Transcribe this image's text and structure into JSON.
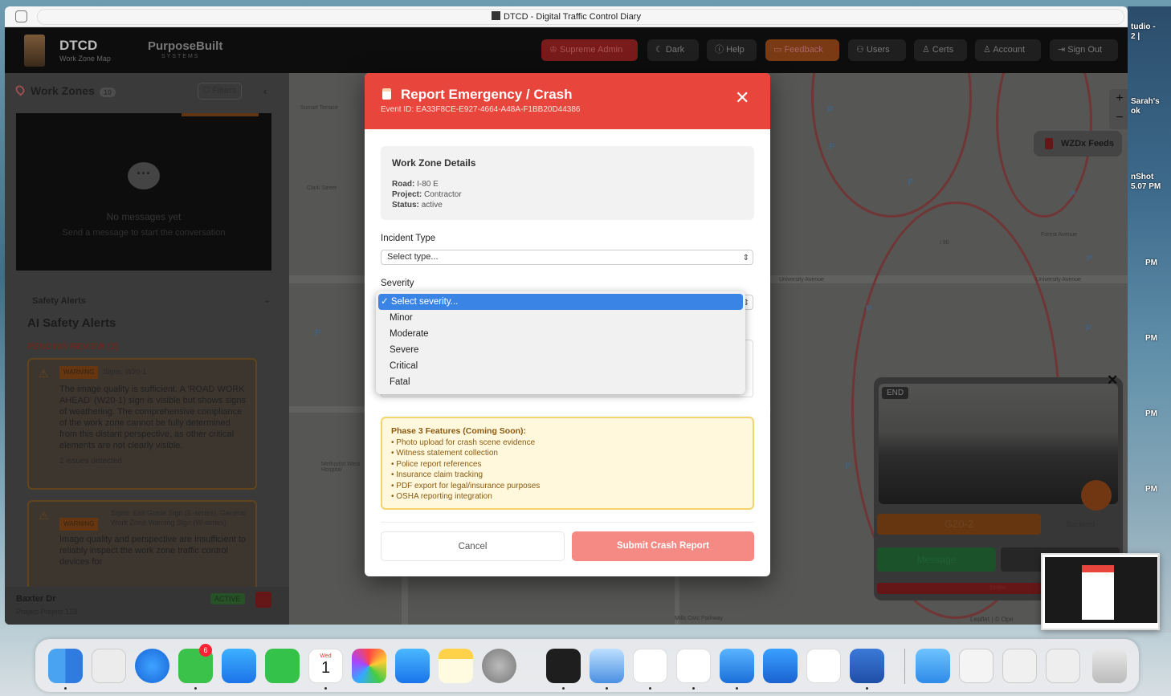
{
  "window": {
    "title": "DTCD - Digital Traffic Control Diary"
  },
  "app": {
    "brand": "DTCD",
    "brand_sub": "Work Zone Map",
    "partner": "PurposeBuilt",
    "partner_sub": "SYSTEMS",
    "nav": [
      "Supreme Admin",
      "Dark",
      "Help",
      "Feedback",
      "Users",
      "Certs",
      "Account",
      "Sign Out"
    ]
  },
  "sidebar": {
    "title": "Work Zones",
    "count": "10",
    "filters": "Filters",
    "chat_empty": "No messages yet",
    "chat_hint": "Send a message to start the conversation",
    "safety_alerts": "Safety Alerts",
    "ai_title": "AI Safety Alerts",
    "pending": "PENDING REVIEW (2)",
    "cards": [
      {
        "tag": "WARNING",
        "signs": "Signs: W20-1",
        "text": "The image quality is sufficient. A 'ROAD WORK AHEAD' (W20-1) sign is visible but shows signs of weathering. The comprehensive compliance of the work zone cannot be fully determined from this distant perspective, as other critical elements are not clearly visible.",
        "issues": "2 issues detected"
      },
      {
        "tag": "WARNING",
        "signs": "Signs: Exit Guide Sign (E-series), General Work Zone Warning Sign (W-series)",
        "text": "Image quality and perspective are insufficient to reliably inspect the work zone traffic control devices for",
        "issues": ""
      }
    ],
    "zone_name": "Baxter Dr",
    "zone_project": "Project Project 123",
    "zone_status": "ACTIVE"
  },
  "map": {
    "wzdx": "WZDx Feeds",
    "labels": [
      "Sunset Terrace",
      "Clark Street",
      "University Avenue",
      "University Avenue",
      "I 80",
      "Forest Avenue",
      "Methodist West Hospital",
      "Mills Civic Parkway"
    ],
    "camera": {
      "end": "END",
      "sign": "G20-2",
      "backend": "Backend",
      "message": "Message",
      "delete": "Delete"
    },
    "attribution": "Leaflet | © Ope"
  },
  "modal": {
    "title": "Report Emergency / Crash",
    "event_id": "Event ID: EA33F8CE-E927-4664-A48A-F1BB20D44386",
    "details": {
      "heading": "Work Zone Details",
      "road_label": "Road:",
      "road": "I-80 E",
      "project_label": "Project:",
      "project": "Contractor",
      "status_label": "Status:",
      "status": "active"
    },
    "incident_label": "Incident Type",
    "incident_value": "Select type...",
    "severity_label": "Severity",
    "severity_options": [
      "Select severity...",
      "Minor",
      "Moderate",
      "Severe",
      "Critical",
      "Fatal"
    ],
    "phase3": {
      "heading": "Phase 3 Features (Coming Soon):",
      "items": [
        "• Photo upload for crash scene evidence",
        "• Witness statement collection",
        "• Police report references",
        "• Insurance claim tracking",
        "• PDF export for legal/insurance purposes",
        "• OSHA reporting integration"
      ]
    },
    "cancel": "Cancel",
    "submit": "Submit Crash Report"
  },
  "desktop": {
    "right_notes": [
      "tudio -",
      "2 |",
      "Sarah's",
      "ok",
      "nShot",
      "5.07 PM",
      "PM",
      "PM",
      "PM",
      "PM"
    ],
    "calendar_month": "Wed",
    "calendar_day": "1",
    "messages_badge": "6",
    "dock": [
      "Finder",
      "Launchpad",
      "Safari",
      "Messages",
      "Mail",
      "FaceTime",
      "Calendar",
      "Photos",
      "App Store",
      "Notes",
      "System Settings",
      "Terminal",
      "Xcode Cloud",
      "TextEdit",
      "ChatGPT",
      "Xcode",
      "Simulator",
      "Instruments",
      "Word",
      "Downloads",
      "Documents",
      "Preview",
      "Screenshot",
      "Trash"
    ]
  },
  "colors": {
    "modal_header": "#e8453c",
    "submit": "#f58a84",
    "phase3_bg": "#fff8dc",
    "selected_option": "#3a84e6"
  }
}
